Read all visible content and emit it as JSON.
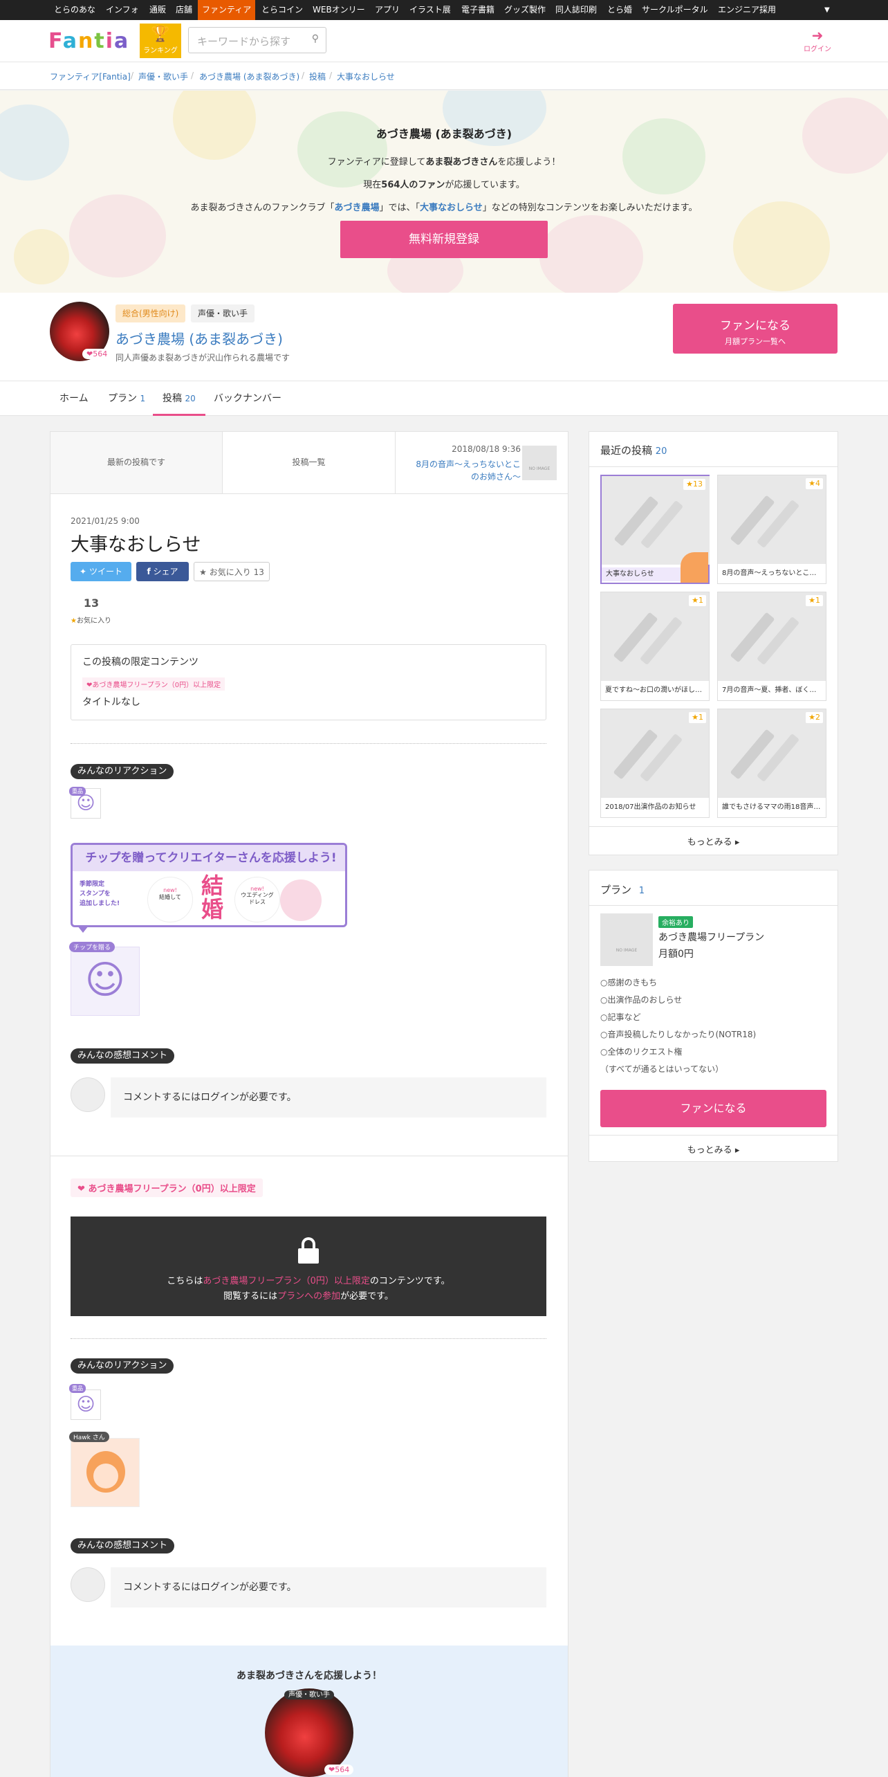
{
  "topnav": [
    "とらのあな",
    "インフォ",
    "通販",
    "店舗",
    "ファンティア",
    "とらコイン",
    "WEBオンリー",
    "アプリ",
    "イラスト展",
    "電子書籍",
    "グッズ製作",
    "同人誌印刷",
    "とら婚",
    "サークルポータル",
    "エンジニア採用"
  ],
  "topnav_active": "ファンティア",
  "topnav_caret": "▼",
  "header": {
    "logo": "Fantia",
    "ranking_label": "ランキング",
    "search_placeholder": "キーワードから探す",
    "login_label": "ログイン"
  },
  "breadcrumb": [
    "ファンティア[Fantia]",
    "声優・歌い手",
    "あづき農場 (あま裂あづき)",
    "投稿",
    "大事なおしらせ"
  ],
  "hero": {
    "title": "あづき農場 (あま裂あづき)",
    "line1_a": "ファンティアに登録して",
    "line1_b": "あま裂あづきさん",
    "line1_c": "を応援しよう！",
    "line2_a": "現在",
    "line2_b": "564人のファン",
    "line2_c": "が応援しています。",
    "line3_a": "あま裂あづきさんのファンクラブ「",
    "line3_b": "あづき農場",
    "line3_c": "」では、「",
    "line3_d": "大事なおしらせ",
    "line3_e": "」などの特別なコンテンツをお楽しみいただけます。",
    "register_button": "無料新規登録"
  },
  "profile": {
    "tag1": "総合(男性向け)",
    "tag2": "声優・歌い手",
    "name": "あづき農場 (あま裂あづき)",
    "description": "同人声優あま裂あづきが沢山作られる農場です",
    "fan_count": "564",
    "fan_button": "ファンになる",
    "fan_button_sub": "月額プラン一覧へ"
  },
  "tabs": [
    {
      "label": "ホーム",
      "count": ""
    },
    {
      "label": "プラン",
      "count": "1"
    },
    {
      "label": "投稿",
      "count": "20"
    },
    {
      "label": "バックナンバー",
      "count": ""
    }
  ],
  "postnav": {
    "latest": "最新の投稿です",
    "list": "投稿一覧",
    "next_date": "2018/08/18 9:36",
    "next_title": "8月の音声～えっちないとこのお姉さん～",
    "no_image": "NO IMAGE"
  },
  "post": {
    "date": "2021/01/25 9:00",
    "title": "大事なおしらせ",
    "tweet": "ツイート",
    "share": "シェア",
    "fav_btn": "お気に入り 13",
    "fav_count": "13",
    "fav_label": "お気に入り",
    "limited_title": "この投稿の限定コンテンツ",
    "limited_plan": "あづき農場フリープラン（0円）以上限定",
    "limited_item": "タイトルなし"
  },
  "reactions": {
    "label": "みんなのリアクション",
    "badge": "重品",
    "tip_banner_title": "チップを贈ってクリエイターさんを応援しよう!",
    "tip_banner_left": "季節限定\nスタンプを\n追加しました!",
    "tip_new1": "new!",
    "tip_item1": "結婚して",
    "tip_new2": "new!",
    "tip_item2": "ウエディング\nドレス",
    "tip_badge": "チップを贈る"
  },
  "comments": {
    "label": "みんなの感想コメント",
    "login_required": "コメントするにはログインが必要です。"
  },
  "locked": {
    "plan_tag": "あづき農場フリープラン（0円）以上限定",
    "line1_a": "こちらは",
    "line1_b": "あづき農場フリープラン（0円）以上限定",
    "line1_c": "のコンテンツです。",
    "line2_a": "閲覧するには",
    "line2_b": "プランへの参加",
    "line2_c": "が必要です。"
  },
  "reactions2": {
    "badge": "重品",
    "hawk": "Hawk さん"
  },
  "support": {
    "title": "あま裂あづきさんを応援しよう！",
    "tag": "声優・歌い手",
    "count": "564"
  },
  "recent": {
    "title": "最近の投稿",
    "count": "20",
    "items": [
      {
        "title": "大事なおしらせ",
        "stars": "13"
      },
      {
        "title": "8月の音声～えっちないとこのお...",
        "stars": "4"
      },
      {
        "title": "夏ですね～お口の潤いがほしいで...",
        "stars": "1"
      },
      {
        "title": "7月の音声～夏、挿者、ぼくっこ～",
        "stars": "1"
      },
      {
        "title": "2018/07出演作品のお知らせ",
        "stars": "1"
      },
      {
        "title": "誰でもさけるママの雨18音声（関...",
        "stars": "2"
      }
    ],
    "more": "もっとみる"
  },
  "plans": {
    "title": "プラン",
    "count": "1",
    "badge": "余裕あり",
    "name": "あづき農場フリープラン",
    "price": "月額0円",
    "no_image": "NO IMAGE",
    "benefits": [
      "○感謝のきもち",
      "○出演作品のおしらせ",
      "○記事など",
      "○音声投稿したりしなかったり(NOTR18)",
      "○全体のリクエスト権",
      "（すべてが通るとはいってない）"
    ],
    "fan_button": "ファンになる",
    "more": "もっとみる"
  },
  "colors": {
    "accent": "#e94e8a",
    "topnav_active": "#e85a00",
    "link": "#3a7bbf",
    "tweet": "#55acee",
    "share": "#3b5998"
  }
}
